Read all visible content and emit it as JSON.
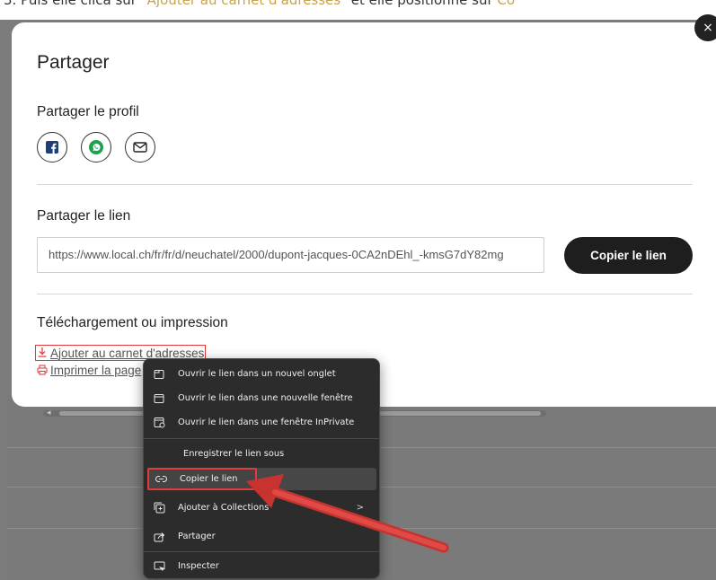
{
  "instruction_strip": {
    "prefix": "3.   Puis elle clica sur",
    "highlight1": "\"Ajouter au carnet d'adresses\"",
    "middle": "et elle positionne sur",
    "highlight2": "Co"
  },
  "modal": {
    "close_icon": "×",
    "title": "Partager",
    "profile_heading": "Partager le profil",
    "share_icons": [
      "facebook-icon",
      "whatsapp-icon",
      "email-icon"
    ],
    "link_heading": "Partager le lien",
    "link_value": "https://www.local.ch/fr/fr/d/neuchatel/2000/dupont-jacques-0CA2nDEhl_-kmsG7dY82mg",
    "copy_button": "Copier le lien",
    "download_heading": "Téléchargement ou impression",
    "add_contacts": "Ajouter au carnet d'adresses",
    "print_page": "Imprimer la page"
  },
  "context_menu": {
    "items": [
      {
        "label": "Ouvrir le lien dans un nouvel onglet",
        "icon": "new-tab-icon"
      },
      {
        "label": "Ouvrir le lien dans une nouvelle fenêtre",
        "icon": "new-window-icon"
      },
      {
        "label": "Ouvrir le lien dans une fenêtre InPrivate",
        "icon": "inprivate-icon"
      },
      {
        "label": "Enregistrer le lien sous",
        "icon": ""
      },
      {
        "label": "Copier le lien",
        "icon": "link-icon"
      },
      {
        "label": "Ajouter à Collections",
        "icon": "collections-icon"
      },
      {
        "label": "Partager",
        "icon": "share-icon"
      },
      {
        "label": "Inspecter",
        "icon": "inspect-icon"
      }
    ]
  },
  "colors": {
    "highlight_red": "#e03a3a",
    "menu_bg": "#2c2c2c",
    "button_dark": "#1e1e1e"
  }
}
